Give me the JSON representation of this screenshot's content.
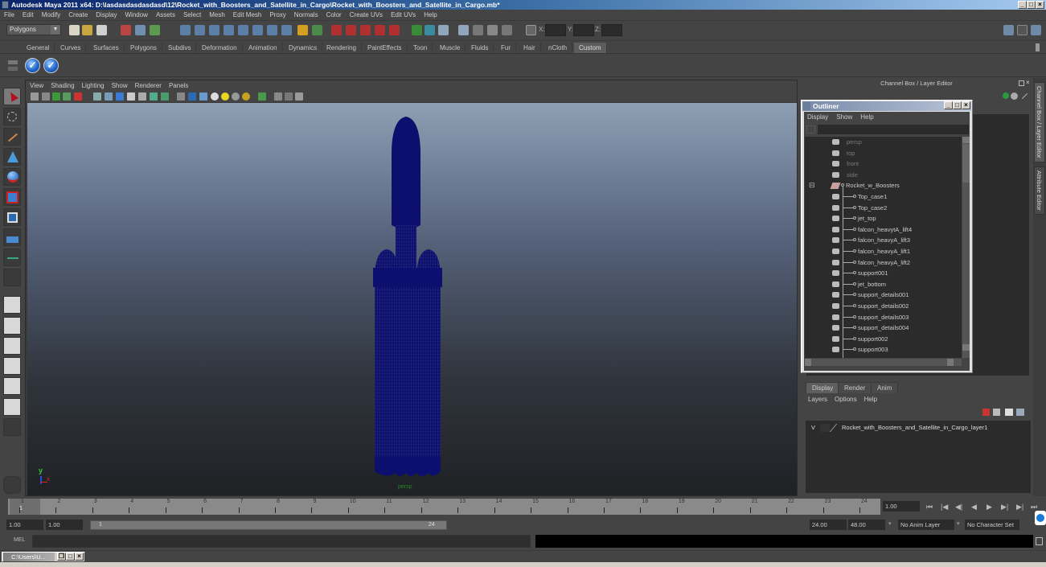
{
  "window": {
    "title": "Autodesk Maya 2011 x64: D:\\lasdasdasdasdasd\\12\\Rocket_with_Boosters_and_Satellite_in_Cargo\\Rocket_with_Boosters_and_Satellite_in_Cargo.mb*",
    "minimize": "_",
    "maximize": "□",
    "close": "×"
  },
  "menubar": [
    "File",
    "Edit",
    "Modify",
    "Create",
    "Display",
    "Window",
    "Assets",
    "Select",
    "Mesh",
    "Edit Mesh",
    "Proxy",
    "Normals",
    "Color",
    "Create UVs",
    "Edit UVs",
    "Help"
  ],
  "statusline": {
    "mode": "Polygons",
    "x_label": "X:",
    "y_label": "Y:",
    "z_label": "Z:",
    "x_value": "",
    "y_value": "",
    "z_value": ""
  },
  "shelf": {
    "tabs": [
      "General",
      "Curves",
      "Surfaces",
      "Polygons",
      "Subdivs",
      "Deformation",
      "Animation",
      "Dynamics",
      "Rendering",
      "PaintEffects",
      "Toon",
      "Muscle",
      "Fluids",
      "Fur",
      "Hair",
      "nCloth",
      "Custom"
    ],
    "active_tab": "Custom",
    "buttons": [
      "check-icon",
      "check-icon"
    ],
    "check_glyph": "✓"
  },
  "panel": {
    "menu": [
      "View",
      "Shading",
      "Lighting",
      "Show",
      "Renderer",
      "Panels"
    ],
    "camera_label": "persp",
    "axis_y": "y",
    "axis_x": "x"
  },
  "channel_box": {
    "title": "Channel Box / Layer Editor",
    "side_tabs": [
      "Channel Box / Layer Editor",
      "Attribute Editor"
    ]
  },
  "outliner": {
    "title": "Outliner",
    "menu": [
      "Display",
      "Show",
      "Help"
    ],
    "filter_value": "",
    "cameras": [
      "persp",
      "top",
      "front",
      "side"
    ],
    "root": "Rocket_w_Boosters",
    "expand_glyph": "⊟",
    "children": [
      "Top_case1",
      "Top_case2",
      "jet_top",
      "falcon_heavytA_lift4",
      "falcon_heavyA_lift3",
      "falcon_heavyA_lift1",
      "falcon_heavyA_lift2",
      "support001",
      "jet_bottom",
      "support_details001",
      "support_details002",
      "support_details003",
      "support_details004",
      "support002",
      "support003"
    ]
  },
  "layer_editor": {
    "tabs": [
      "Display",
      "Render",
      "Anim"
    ],
    "active_tab": "Display",
    "menu": [
      "Layers",
      "Options",
      "Help"
    ],
    "layers": [
      {
        "visible": "V",
        "name": "Rocket_with_Boosters_and_Satellite_in_Cargo_layer1"
      }
    ]
  },
  "timeline": {
    "ticks": [
      "1",
      "2",
      "3",
      "4",
      "5",
      "6",
      "7",
      "8",
      "9",
      "10",
      "11",
      "12",
      "13",
      "14",
      "15",
      "16",
      "17",
      "18",
      "19",
      "20",
      "21",
      "22",
      "23",
      "24"
    ],
    "current_frame_marker": "1",
    "current_time": "1.00",
    "playback_buttons": [
      "⏮",
      "|◀",
      "◀|",
      "◀",
      "▶",
      "▶|",
      "▶|",
      "⏭"
    ]
  },
  "range": {
    "start_time": "1.00",
    "playback_start": "1.00",
    "range_start_label": "1",
    "range_end_label": "24",
    "playback_end": "24.00",
    "end_time": "48.00",
    "anim_layer": "No Anim Layer",
    "character_set": "No Character Set"
  },
  "command_line": {
    "label": "MEL",
    "value": ""
  },
  "taskbar": {
    "minimized_window": "C:\\Users\\U..."
  },
  "colors": {
    "mesh": "#0d0f6e",
    "camera_label": "#1f8a2a",
    "axis_y": "#33cc33",
    "axis_x": "#dd2222"
  }
}
